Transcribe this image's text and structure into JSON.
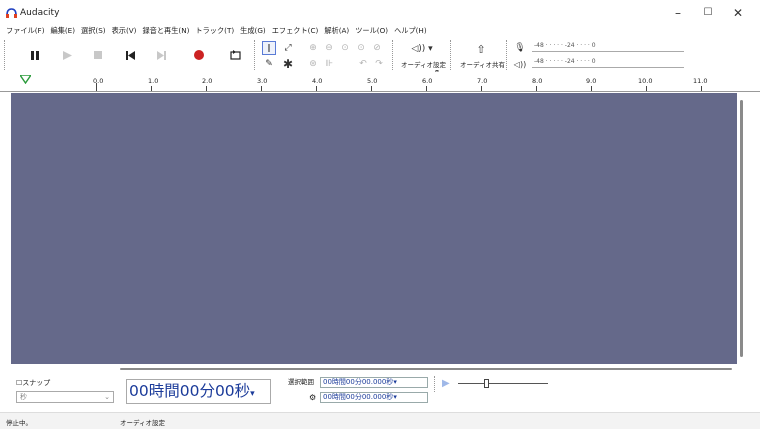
{
  "window": {
    "title": "Audacity",
    "minimize": "–",
    "maximize": "☐",
    "close": "✕"
  },
  "menu": [
    "ファイル(F)",
    "編集(E)",
    "選択(S)",
    "表示(V)",
    "録音と再生(N)",
    "トラック(T)",
    "生成(G)",
    "エフェクト(C)",
    "解析(A)",
    "ツール(O)",
    "ヘルプ(H)"
  ],
  "toolbar": {
    "audio_setup_label": "オーディオ設定",
    "share_audio_label": "オーディオ共有",
    "meter_scale": "-48 · · · · · -24 · · · · 0",
    "record_meter_lr": "L\nR",
    "play_meter_lr": "L\nR"
  },
  "ruler": {
    "ticks": [
      "0.0",
      "1.0",
      "2.0",
      "3.0",
      "4.0",
      "5.0",
      "6.0",
      "7.0",
      "8.0",
      "9.0",
      "10.0",
      "11.0"
    ]
  },
  "bottom": {
    "snap_label": "スナップ",
    "snap_unit": "秒",
    "time_display": "00時間00分00秒",
    "selection_label": "選択範囲",
    "selection_start": "00時間00分00.000秒",
    "selection_end": "00時間00分00.000秒"
  },
  "status": {
    "state": "停止中。",
    "info": "オーディオ設定"
  },
  "colors": {
    "track_bg": "#65698a",
    "record": "#cc2222",
    "time_text": "#1b3b9a"
  }
}
